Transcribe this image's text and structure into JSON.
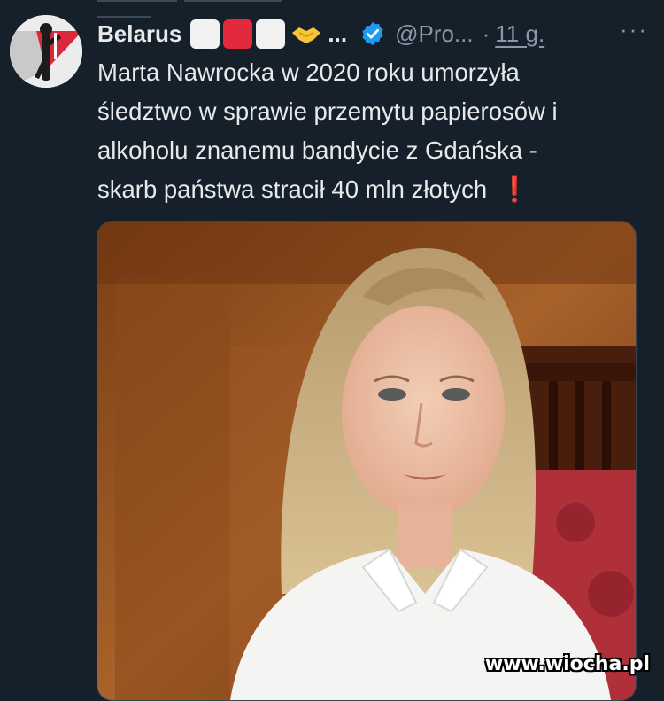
{
  "author": {
    "name": "Belarus",
    "handle": "@Pro...",
    "time": "11 g.",
    "dot": "·",
    "ellipsis": "...",
    "more": "···"
  },
  "tweet": {
    "lines": [
      "Marta Nawrocka w 2020 roku umorzyła",
      "śledztwo w sprawie przemytu papierosów i",
      "alkoholu znanemu bandycie z Gdańska -",
      "skarb państwa stracił 40 mln złotych"
    ],
    "emoji": "❗"
  },
  "watermark": "www.wiocha.pl",
  "colors": {
    "background": "#15202b",
    "flag_red": "#e3293c",
    "verified_blue": "#1d9bf0",
    "muted": "#8b98a5"
  }
}
